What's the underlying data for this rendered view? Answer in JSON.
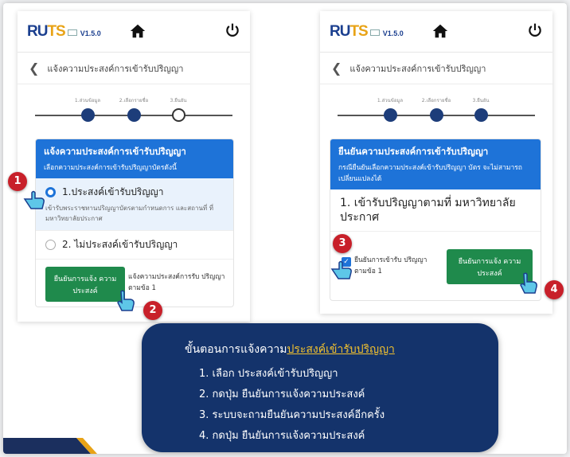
{
  "app": {
    "logo_ru": "RU",
    "logo_ts": "TS",
    "version": "V1.5.0"
  },
  "page_title": "แจ้งความประสงค์การเข้ารับปริญญา",
  "stepper": {
    "labels": [
      "1.ส่วนข้อมูล",
      "2.เลือกรายชื่อ",
      "3.ยืนยัน"
    ]
  },
  "left": {
    "card_title": "แจ้งความประสงค์การเข้ารับปริญญา",
    "card_subtitle": "เลือกความประสงค์การเข้ารับปริญญาบัตรดังนี้",
    "option1_label": "1.ประสงค์เข้ารับปริญญา",
    "option1_desc": "เข้ารับพระราชทานปริญญาบัตรตามกำหนดการ และสถานที่ ที่มหาวิทยาลัยประกาศ",
    "option2_label": "2. ไม่ประสงค์เข้ารับปริญญา",
    "confirm_button": "ยืนยันการแจ้ง ความประสงค์",
    "confirm_note": "แจ้งความประสงค์การรับ ปริญญา ตามข้อ 1"
  },
  "right": {
    "card_title": "ยืนยันความประสงค์การเข้ารับปริญญา",
    "card_subtitle": "กรณียืนยันเลือกความประสงค์เข้ารับปริญญา บัตร จะไม่สามารถเปลี่ยนแปลงได้",
    "selected_text": "1. เข้ารับปริญญาตามที่ มหาวิทยาลัยประกาศ",
    "checkbox_label": "ยืนยันการเข้ารับ ปริญญา ตามข้อ 1",
    "confirm_button": "ยืนยันการแจ้ง ความประสงค์"
  },
  "badges": [
    "1",
    "2",
    "3",
    "4"
  ],
  "instructions": {
    "title_prefix": "ขั้นตอนการแจ้งความ",
    "title_highlight": "ประสงค์เข้ารับปริญญา",
    "steps": [
      "1. เลือก ประสงค์เข้ารับปริญญา",
      "2. กดปุ่ม ยืนยันการแจ้งความประสงค์",
      "3. ระบบจะถามยืนยันความประสงค์อีกครั้ง",
      "4. กดปุ่ม ยืนยันการแจ้งความประสงค์"
    ]
  },
  "colors": {
    "primary_blue": "#1e73d8",
    "navy": "#14336b",
    "green": "#1f8a4c",
    "badge_red": "#c8202a",
    "gold": "#f2c12e"
  },
  "icons": [
    "home-icon",
    "power-icon",
    "back-chevron-icon",
    "hand-pointer-icon",
    "check-icon"
  ]
}
